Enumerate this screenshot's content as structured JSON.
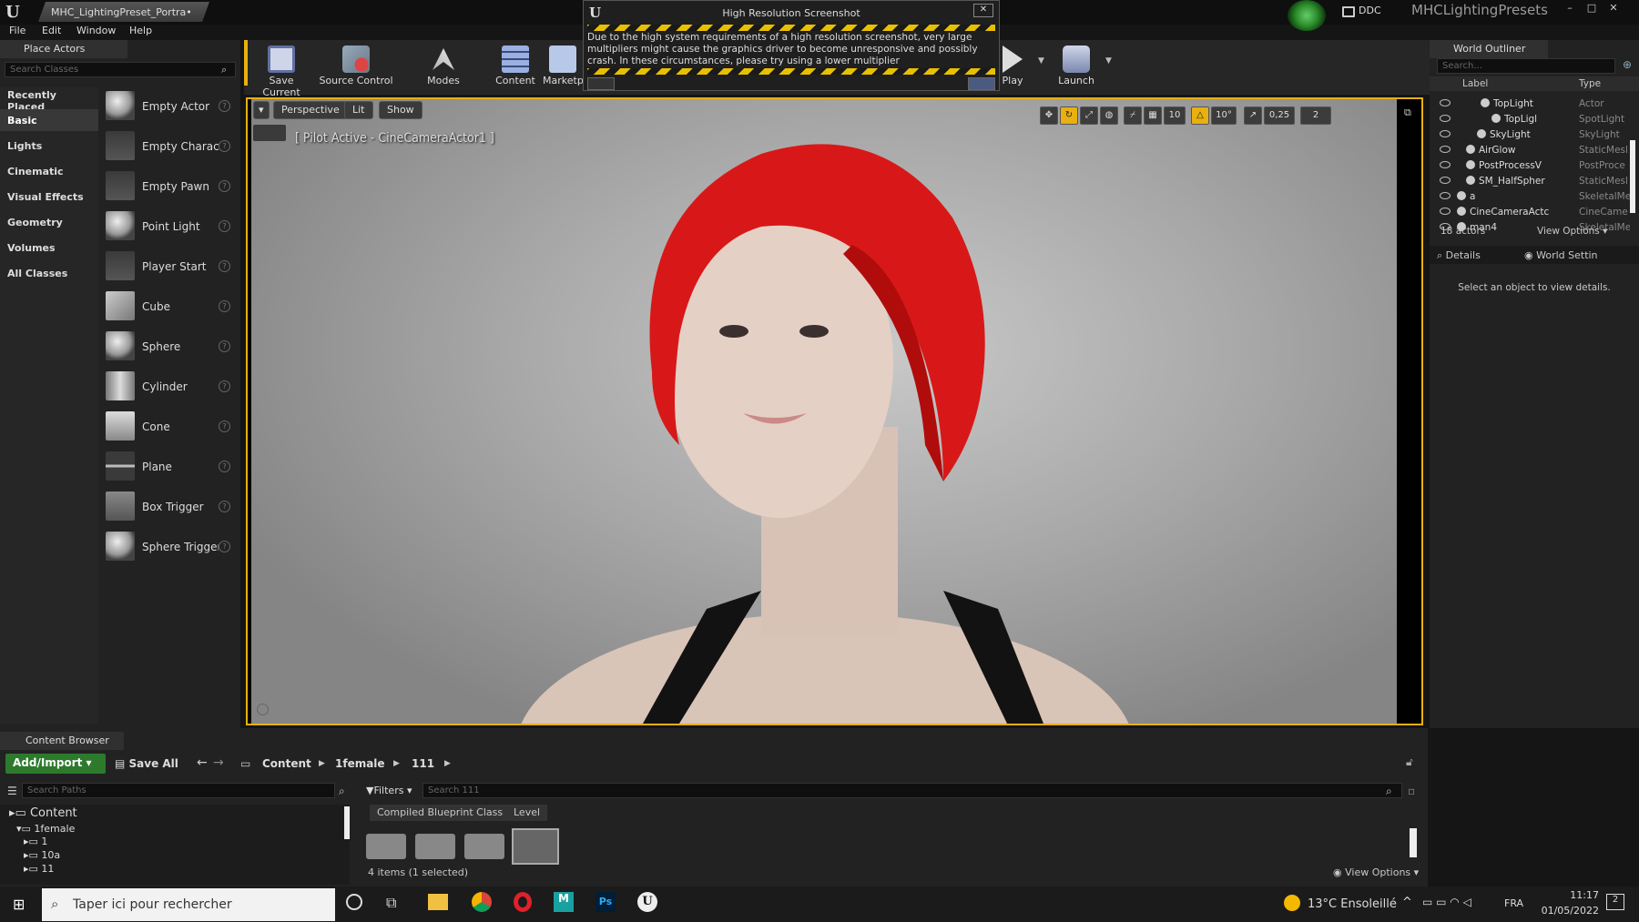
{
  "titlebar": {
    "doc_tab": "MHC_LightingPreset_Portra•",
    "project": "MHCLightingPresets",
    "ddc": "DDC"
  },
  "menu": [
    "File",
    "Edit",
    "Window",
    "Help"
  ],
  "place_actors": {
    "tab": "Place Actors",
    "search_placeholder": "Search Classes",
    "categories": [
      "Recently Placed",
      "Basic",
      "Lights",
      "Cinematic",
      "Visual Effects",
      "Geometry",
      "Volumes",
      "All Classes"
    ],
    "actors": [
      "Empty Actor",
      "Empty Charact",
      "Empty Pawn",
      "Point Light",
      "Player Start",
      "Cube",
      "Sphere",
      "Cylinder",
      "Cone",
      "Plane",
      "Box Trigger",
      "Sphere Trigger"
    ]
  },
  "toolbar": {
    "save": "Save Current",
    "source": "Source Control",
    "modes": "Modes",
    "content": "Content",
    "market": "Marketp",
    "play": "Play",
    "launch": "Launch"
  },
  "modal": {
    "title": "High Resolution Screenshot",
    "text": "Due to the high system requirements of a high resolution screenshot, very large multipliers might cause the graphics driver to become unresponsive and possibly crash. In these circumstances, please try using a lower multiplier"
  },
  "viewport": {
    "perspective": "Perspective",
    "lit": "Lit",
    "show": "Show",
    "pilot": "[ Pilot Active - CineCameraActor1 ]",
    "grid": "10",
    "angle": "10°",
    "scale": "0,25",
    "cam": "2"
  },
  "outliner": {
    "tab": "World Outliner",
    "search_placeholder": "Search...",
    "col_label": "Label",
    "col_type": "Type",
    "rows": [
      {
        "label": "TopLight",
        "type": "Actor"
      },
      {
        "label": "TopLigl",
        "type": "SpotLight"
      },
      {
        "label": "SkyLight",
        "type": "SkyLight"
      },
      {
        "label": "AirGlow",
        "type": "StaticMesl"
      },
      {
        "label": "PostProcessV",
        "type": "PostProce"
      },
      {
        "label": "SM_HalfSpher",
        "type": "StaticMesl"
      },
      {
        "label": "a",
        "type": "SkeletalMe"
      },
      {
        "label": "CineCameraActc",
        "type": "CineCame"
      },
      {
        "label": "man4",
        "type": "SkeletalMe"
      }
    ],
    "count": "18 actors",
    "view_options": "View Options"
  },
  "details": {
    "tab": "Details",
    "world_tab": "World Settin",
    "empty": "Select an object to view details."
  },
  "content_browser": {
    "tab": "Content Browser",
    "add_import": "Add/Import",
    "save_all": "Save All",
    "breadcrumb": [
      "Content",
      "1female",
      "111"
    ],
    "search_paths": "Search Paths",
    "filters": "Filters",
    "search": "Search 111",
    "filter_chips": [
      "Compiled Blueprint Class",
      "Level"
    ],
    "tree": [
      "Content",
      "1female",
      "1",
      "10a",
      "11"
    ],
    "status": "4 items (1 selected)",
    "view_options": "View Options"
  },
  "taskbar": {
    "search": "Taper ici pour rechercher",
    "weather": "13°C Ensoleillé",
    "lang": "FRA",
    "time": "11:17",
    "date": "01/05/2022",
    "notif": "2"
  }
}
